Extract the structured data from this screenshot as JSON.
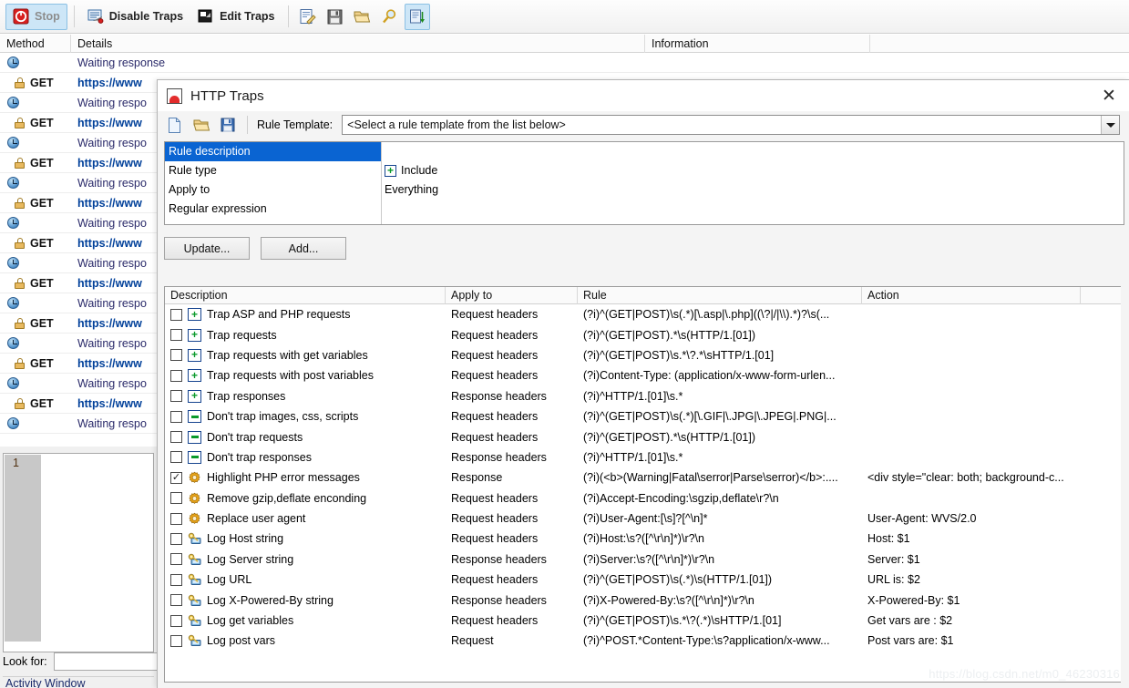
{
  "background_app": {
    "toolbar": {
      "stop_label": "Stop",
      "disable_traps_label": "Disable Traps",
      "edit_traps_label": "Edit Traps",
      "icons": [
        "edit-note-icon",
        "save-icon",
        "open-folder-icon",
        "search-icon",
        "export-document-icon"
      ]
    },
    "grid_headers": {
      "method": "Method",
      "details": "Details",
      "information": "Information"
    },
    "rows": [
      {
        "type": "wait",
        "method": "",
        "details": "Waiting response"
      },
      {
        "type": "get",
        "method": "GET",
        "details": "https://www"
      },
      {
        "type": "wait",
        "method": "",
        "details": "Waiting respo"
      },
      {
        "type": "get",
        "method": "GET",
        "details": "https://www"
      },
      {
        "type": "wait",
        "method": "",
        "details": "Waiting respo"
      },
      {
        "type": "get",
        "method": "GET",
        "details": "https://www"
      },
      {
        "type": "wait",
        "method": "",
        "details": "Waiting respo"
      },
      {
        "type": "get",
        "method": "GET",
        "details": "https://www"
      },
      {
        "type": "wait",
        "method": "",
        "details": "Waiting respo"
      },
      {
        "type": "get",
        "method": "GET",
        "details": "https://www"
      },
      {
        "type": "wait",
        "method": "",
        "details": "Waiting respo"
      },
      {
        "type": "get",
        "method": "GET",
        "details": "https://www"
      },
      {
        "type": "wait",
        "method": "",
        "details": "Waiting respo"
      },
      {
        "type": "get",
        "method": "GET",
        "details": "https://www"
      },
      {
        "type": "wait",
        "method": "",
        "details": "Waiting respo"
      },
      {
        "type": "get",
        "method": "GET",
        "details": "https://www"
      },
      {
        "type": "wait",
        "method": "",
        "details": "Waiting respo"
      },
      {
        "type": "get",
        "method": "GET",
        "details": "https://www"
      },
      {
        "type": "wait",
        "method": "",
        "details": "Waiting respo"
      }
    ],
    "editor": {
      "line_number": "1"
    },
    "look_for": {
      "label": "Look for:",
      "value": "",
      "placeholder": ""
    },
    "activity_window_label": "Activity Window"
  },
  "dialog": {
    "title": "HTTP Traps",
    "close_label": "✕",
    "toolbar": {
      "new_icon": "new-document-icon",
      "open_icon": "open-folder-icon",
      "save_icon": "save-icon",
      "rule_template_label": "Rule Template:",
      "rule_template_value": "<Select a rule template from the list below>"
    },
    "properties": [
      {
        "name": "Rule description",
        "value": "",
        "selected": true,
        "icon": ""
      },
      {
        "name": "Rule type",
        "value": "Include",
        "selected": false,
        "icon": "include-plus-icon"
      },
      {
        "name": "Apply to",
        "value": "Everything",
        "selected": false,
        "icon": ""
      },
      {
        "name": "Regular expression",
        "value": "",
        "selected": false,
        "icon": ""
      }
    ],
    "buttons": {
      "update": "Update...",
      "add": "Add..."
    },
    "list_headers": {
      "description": "Description",
      "apply_to": "Apply to",
      "rule": "Rule",
      "action": "Action"
    },
    "rules": [
      {
        "checked": false,
        "icon": "include-plus-icon",
        "description": "Trap ASP and PHP requests",
        "apply_to": "Request headers",
        "rule": "(?i)^(GET|POST)\\s(.*)[\\.asp|\\.php]((\\?|/|\\\\).*)?\\s(...",
        "action": ""
      },
      {
        "checked": false,
        "icon": "include-plus-icon",
        "description": "Trap requests",
        "apply_to": "Request headers",
        "rule": "(?i)^(GET|POST).*\\s(HTTP/1.[01])",
        "action": ""
      },
      {
        "checked": false,
        "icon": "include-plus-icon",
        "description": "Trap requests with get variables",
        "apply_to": "Request headers",
        "rule": "(?i)^(GET|POST)\\s.*\\?.*\\sHTTP/1.[01]",
        "action": ""
      },
      {
        "checked": false,
        "icon": "include-plus-icon",
        "description": "Trap requests with post variables",
        "apply_to": "Request headers",
        "rule": "(?i)Content-Type: (application/x-www-form-urlen...",
        "action": ""
      },
      {
        "checked": false,
        "icon": "include-plus-icon",
        "description": "Trap responses",
        "apply_to": "Response headers",
        "rule": "(?i)^HTTP/1.[01]\\s.*",
        "action": ""
      },
      {
        "checked": false,
        "icon": "exclude-minus-icon",
        "description": "Don't trap images, css, scripts",
        "apply_to": "Request headers",
        "rule": "(?i)^(GET|POST)\\s(.*)[\\.GIF|\\.JPG|\\.JPEG|.PNG|...",
        "action": ""
      },
      {
        "checked": false,
        "icon": "exclude-minus-icon",
        "description": "Don't trap requests",
        "apply_to": "Request headers",
        "rule": "(?i)^(GET|POST).*\\s(HTTP/1.[01])",
        "action": ""
      },
      {
        "checked": false,
        "icon": "exclude-minus-icon",
        "description": "Don't trap responses",
        "apply_to": "Response headers",
        "rule": "(?i)^HTTP/1.[01]\\s.*",
        "action": ""
      },
      {
        "checked": true,
        "icon": "gear-icon",
        "description": "Highlight PHP error messages",
        "apply_to": "Response",
        "rule": "(?i)(<b>(Warning|Fatal\\serror|Parse\\serror)</b>:....",
        "action": "<div style=\"clear: both; background-c..."
      },
      {
        "checked": false,
        "icon": "gear-icon",
        "description": "Remove gzip,deflate enconding",
        "apply_to": "Request headers",
        "rule": "(?i)Accept-Encoding:\\sgzip,deflate\\r?\\n",
        "action": ""
      },
      {
        "checked": false,
        "icon": "gear-icon",
        "description": "Replace user agent",
        "apply_to": "Request headers",
        "rule": "(?i)User-Agent:[\\s]?[^\\n]*",
        "action": "User-Agent: WVS/2.0"
      },
      {
        "checked": false,
        "icon": "key-icon",
        "description": "Log Host string",
        "apply_to": "Request headers",
        "rule": "(?i)Host:\\s?([^\\r\\n]*)\\r?\\n",
        "action": "Host: $1"
      },
      {
        "checked": false,
        "icon": "key-icon",
        "description": "Log Server string",
        "apply_to": "Response headers",
        "rule": "(?i)Server:\\s?([^\\r\\n]*)\\r?\\n",
        "action": "Server: $1"
      },
      {
        "checked": false,
        "icon": "key-icon",
        "description": "Log URL",
        "apply_to": "Request headers",
        "rule": "(?i)^(GET|POST)\\s(.*)\\s(HTTP/1.[01])",
        "action": "URL is: $2"
      },
      {
        "checked": false,
        "icon": "key-icon",
        "description": "Log X-Powered-By string",
        "apply_to": "Response headers",
        "rule": "(?i)X-Powered-By:\\s?([^\\r\\n]*)\\r?\\n",
        "action": "X-Powered-By: $1"
      },
      {
        "checked": false,
        "icon": "key-icon",
        "description": "Log get variables",
        "apply_to": "Request headers",
        "rule": "(?i)^(GET|POST)\\s.*\\?(.*)\\sHTTP/1.[01]",
        "action": "Get vars are : $2"
      },
      {
        "checked": false,
        "icon": "key-icon",
        "description": "Log post vars",
        "apply_to": "Request",
        "rule": "(?i)^POST.*Content-Type:\\s?application/x-www...",
        "action": "Post vars are: $1"
      }
    ]
  },
  "watermark": "https://blog.csdn.net/m0_46230316",
  "colors": {
    "selection_blue": "#0a64d2",
    "toolbar_active": "#cde6f7",
    "link_blue": "#00409a",
    "include_green": "#0a9a2a"
  }
}
